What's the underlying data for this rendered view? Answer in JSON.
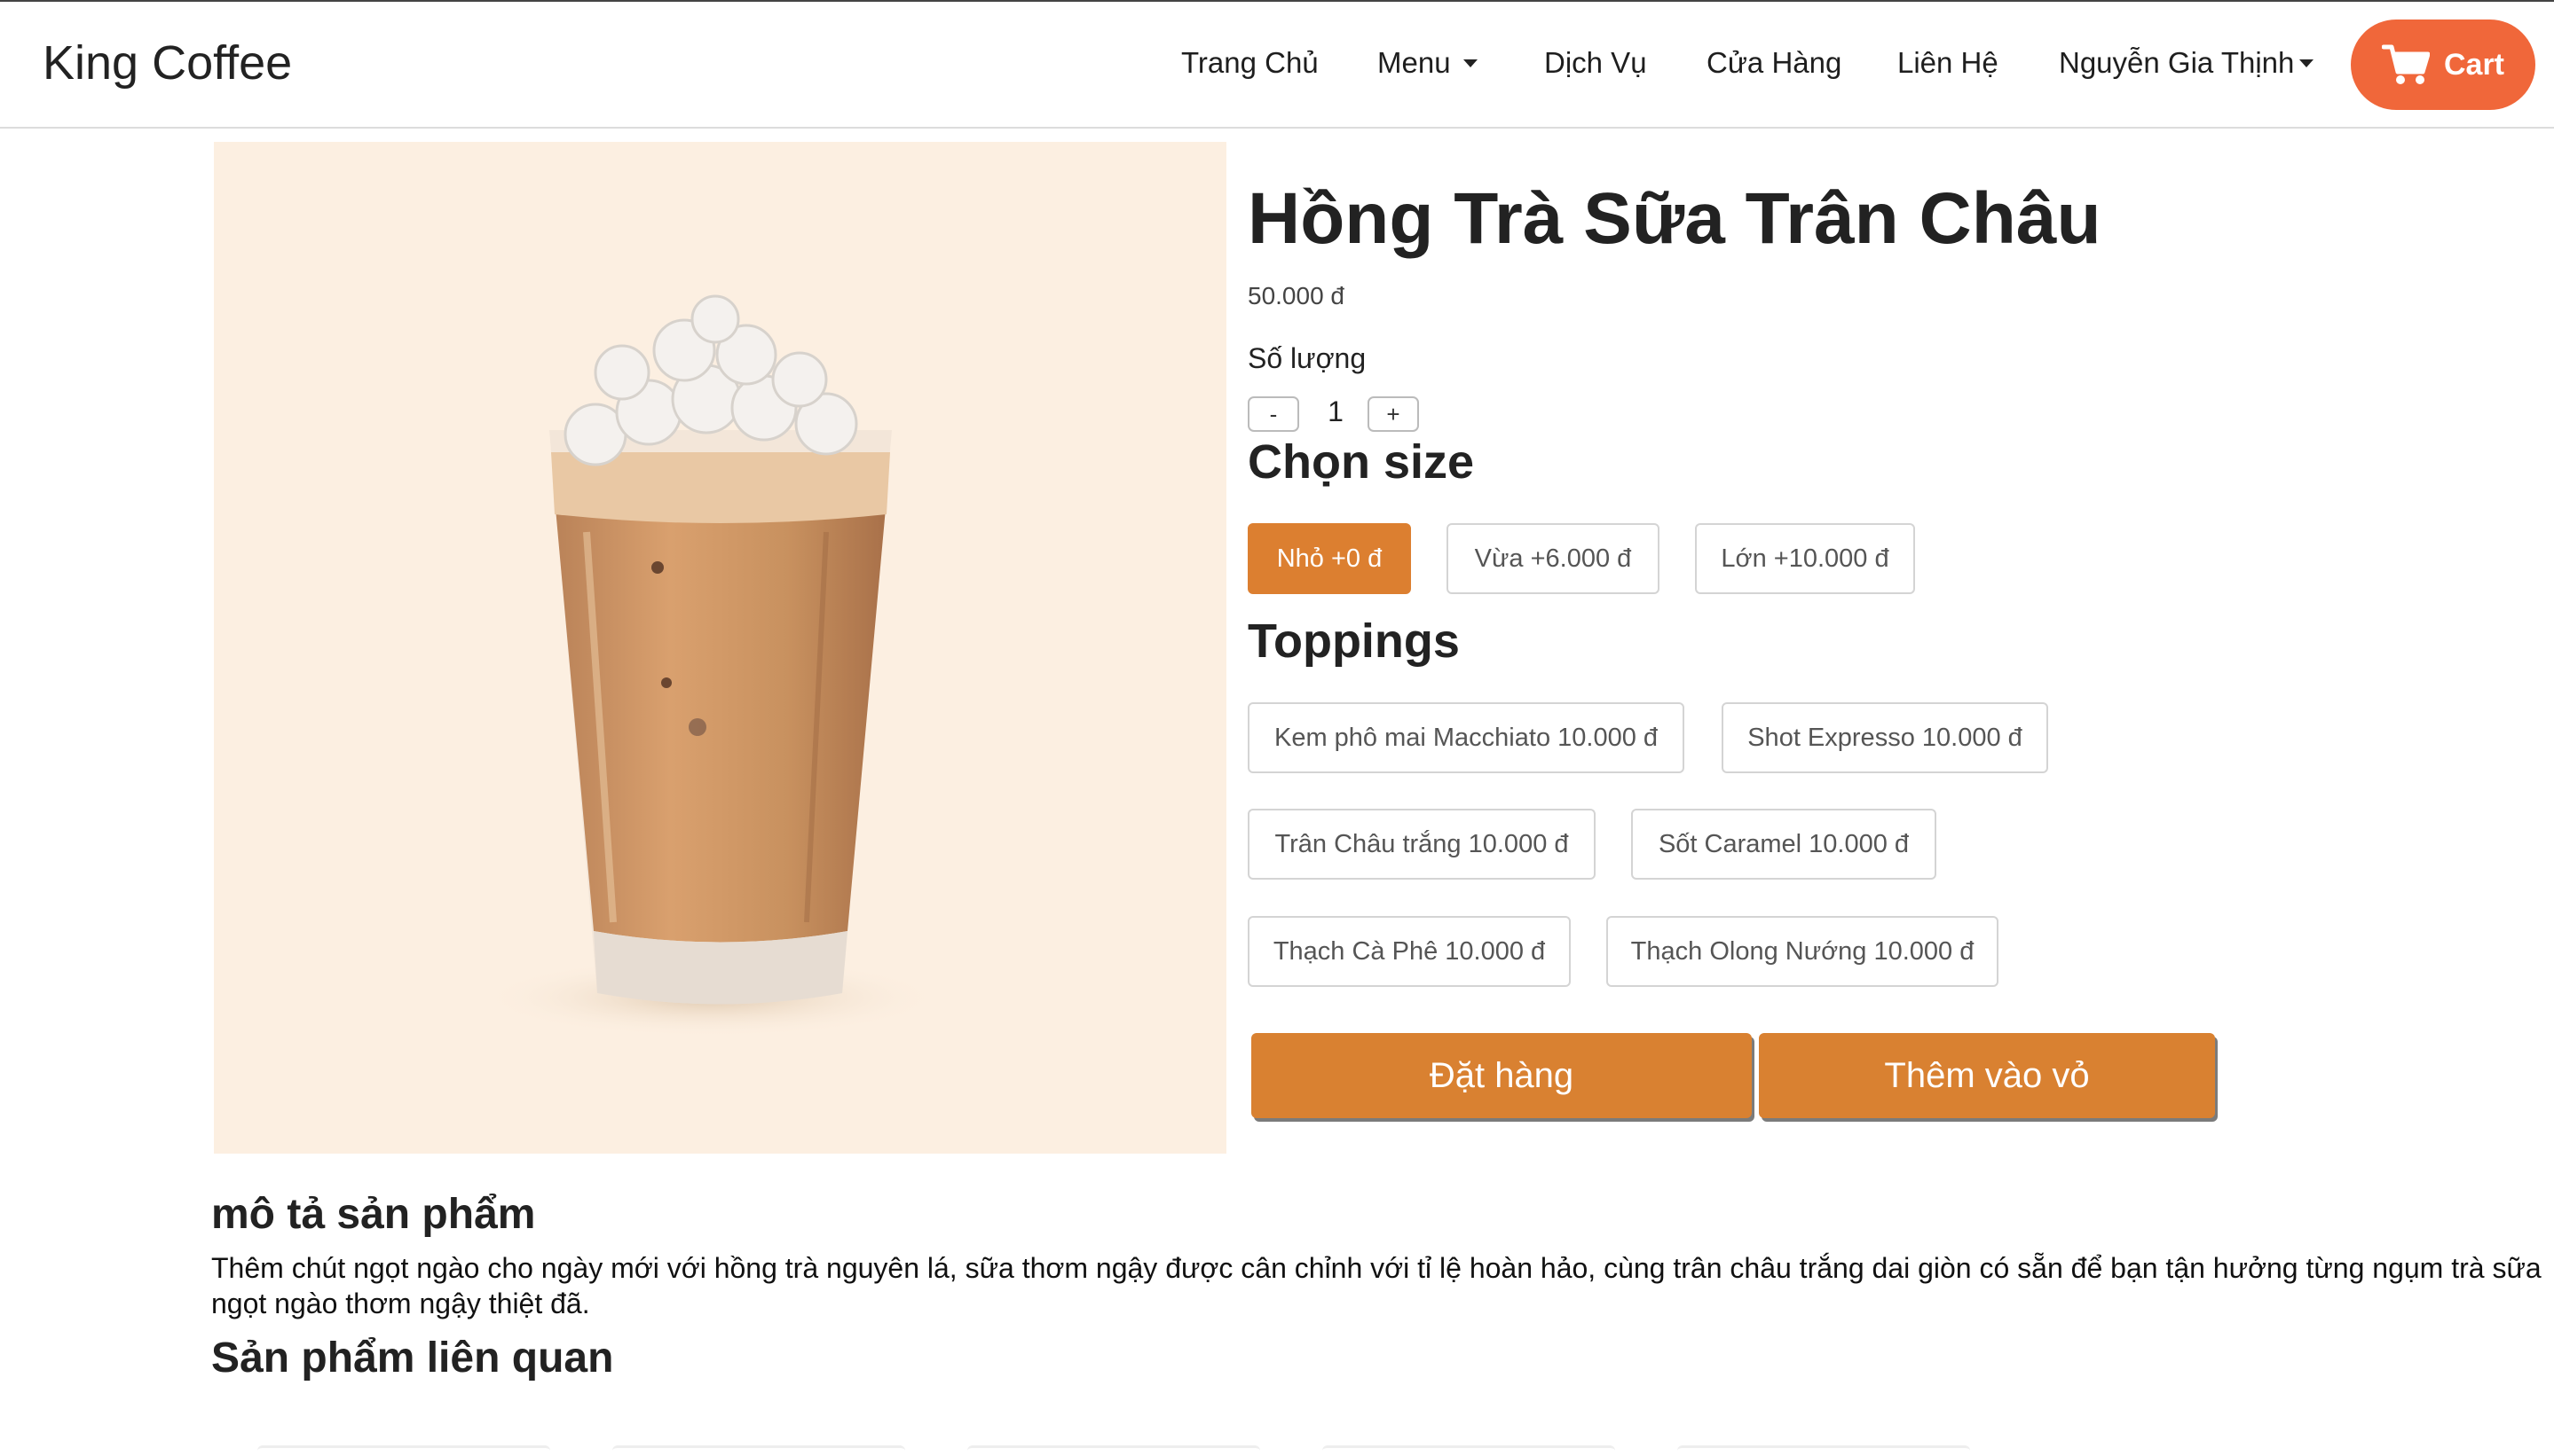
{
  "navbar": {
    "brand": "King Coffee",
    "items": [
      "Trang Chủ",
      "Menu",
      "Dịch Vụ",
      "Cửa Hàng",
      "Liên Hệ"
    ],
    "user": "Nguyễn Gia Thịnh",
    "cart_label": "Cart",
    "accent_color": "#f0673a"
  },
  "product": {
    "name": "Hồng Trà Sữa Trân Châu",
    "price": "50.000 đ",
    "quantity_label": "Số lượng",
    "decrement": "-",
    "quantity": "1",
    "increment": "+",
    "image_icon": "iced-milk-tea-image"
  },
  "size": {
    "heading": "Chọn size",
    "options": [
      "Nhỏ +0 đ",
      "Vừa +6.000 đ",
      "Lớn +10.000 đ"
    ],
    "selected": "Nhỏ +0 đ",
    "selected_color": "#dc7f30"
  },
  "toppings": {
    "heading": "Toppings",
    "options": [
      "Kem phô mai Macchiato 10.000 đ",
      "Shot Expresso 10.000 đ",
      "Trân Châu trắng 10.000 đ",
      "Sốt Caramel 10.000 đ",
      "Thạch Cà Phê 10.000 đ",
      "Thạch Olong Nướng 10.000 đ"
    ]
  },
  "actions": {
    "order": "Đặt hàng",
    "add_to_cart": "Thêm vào vỏ",
    "color": "#d98131"
  },
  "description": {
    "heading": "mô tả sản phẩm",
    "text": "Thêm chút ngọt ngào cho ngày mới với hồng trà nguyên lá, sữa thơm ngậy được cân chỉnh với tỉ lệ hoàn hảo, cùng trân châu trắng dai giòn có sẵn để bạn tận hưởng từng ngụm trà sữa ngọt ngào thơm ngậy thiệt đã."
  },
  "related": {
    "heading": "Sản phẩm liên quan"
  }
}
